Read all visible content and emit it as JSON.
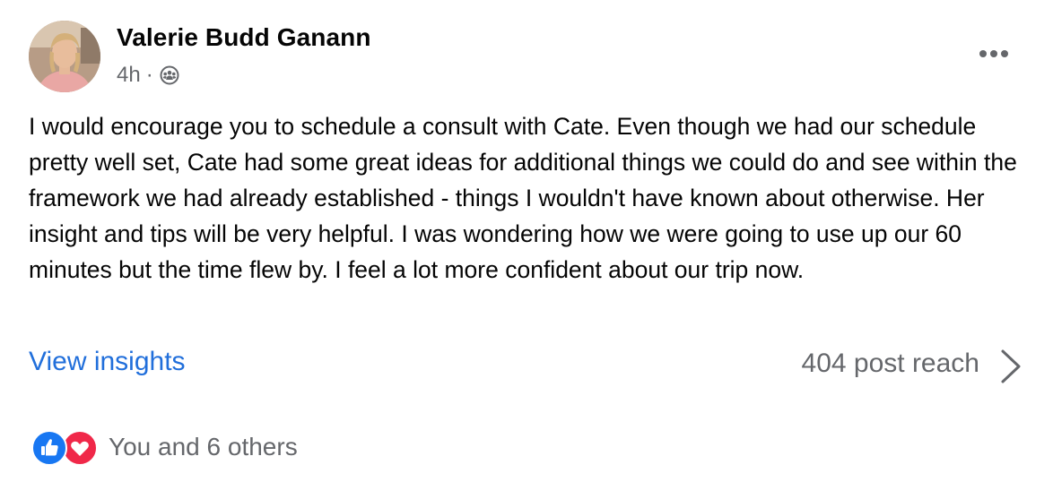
{
  "post": {
    "author": "Valerie Budd Ganann",
    "time": "4h",
    "separator": "·",
    "audience_icon": "friends-icon",
    "more_icon": "more-horizontal-icon",
    "body": "I would encourage you to schedule a consult with Cate. Even though we had our schedule pretty well set, Cate had some great ideas for additional things we could do and see within the framework we had already established - things I wouldn't have known about otherwise. Her insight and tips will be very helpful. I was wondering how we were going to use up our 60 minutes but the time flew by. I feel a lot more confident about our trip now."
  },
  "insights": {
    "link_label": "View insights",
    "reach_label": "404 post reach"
  },
  "reactions": {
    "icons": [
      "like-icon",
      "love-icon"
    ],
    "summary": "You and 6 others"
  },
  "colors": {
    "link": "#216fdb",
    "secondary_text": "#65676b",
    "like": "#1877f2",
    "love": "#f02849"
  }
}
